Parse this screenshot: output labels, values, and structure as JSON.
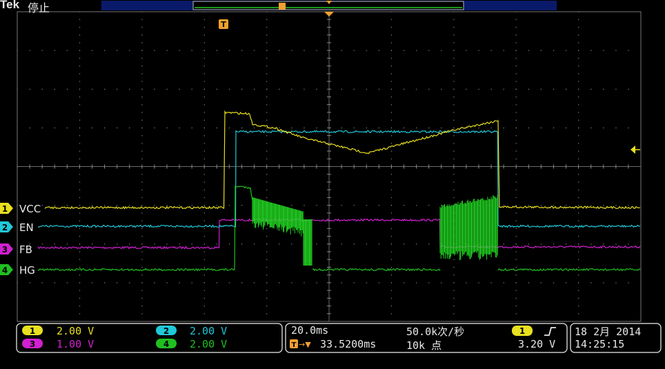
{
  "header": {
    "brand": "Tek",
    "acq_state": "停止",
    "trigger_marker": "T"
  },
  "channels": [
    {
      "id": "1",
      "label": "VCC",
      "color": "#e8e020",
      "scale": "2.00 V"
    },
    {
      "id": "2",
      "label": "EN",
      "color": "#20c8d8",
      "scale": "2.00 V"
    },
    {
      "id": "3",
      "label": "FB",
      "color": "#d020d0",
      "scale": "1.00 V"
    },
    {
      "id": "4",
      "label": "HG",
      "color": "#20c020",
      "scale": "2.00 V"
    }
  ],
  "timebase": {
    "time_per_div": "20.0ms",
    "sample_rate": "50.0k次/秒",
    "trigger_delay": "33.5200ms",
    "record_length": "10k 点"
  },
  "trigger": {
    "source": "1",
    "slope_icon": "rising-edge-icon",
    "level": "3.20 V"
  },
  "datetime": {
    "date": "18 2月  2014",
    "time": "14:25:15"
  },
  "colors": {
    "graticule": "#8a8a8a",
    "trigger_orange": "#f0a030",
    "panel_border": "#c8c8c8"
  }
}
